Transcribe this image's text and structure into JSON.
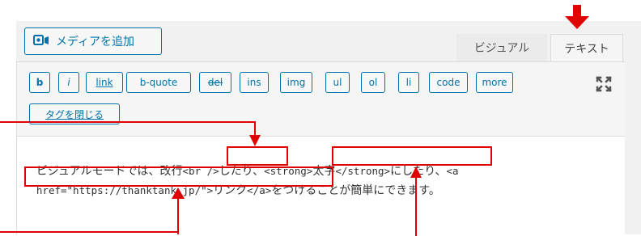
{
  "toolbar": {
    "add_media_label": "メディアを追加",
    "tabs": [
      {
        "label": "ビジュアル",
        "active": false
      },
      {
        "label": "テキスト",
        "active": true
      }
    ],
    "quicktags": [
      "b",
      "i",
      "link",
      "b-quote",
      "del",
      "ins",
      "img",
      "ul",
      "ol",
      "li",
      "code",
      "more"
    ],
    "close_tags_label": "タグを閉じる"
  },
  "content": {
    "line1": [
      {
        "text": "ビジュアルモードでは、改行",
        "mono": false
      },
      {
        "text": "<br />",
        "mono": true
      },
      {
        "text": "したり、",
        "mono": false
      },
      {
        "text": "<strong>",
        "mono": true
      },
      {
        "text": "太字",
        "mono": false
      },
      {
        "text": "</strong>",
        "mono": true
      },
      {
        "text": "にしたり、",
        "mono": false
      },
      {
        "text": "<a",
        "mono": true
      }
    ],
    "line2": [
      {
        "text": "href=\"https://thanktank.jp/\">",
        "mono": true
      },
      {
        "text": "リンク",
        "mono": false
      },
      {
        "text": "</a>",
        "mono": true
      },
      {
        "text": "をつけることが簡単にできます。",
        "mono": false
      }
    ]
  },
  "colors": {
    "accent": "#0073aa",
    "annotation": "#e00000",
    "toolbar_bg": "#f5f5f5",
    "frame_bg": "#f1f1f1"
  },
  "icons": [
    "media-icon",
    "fullscreen-icon"
  ]
}
